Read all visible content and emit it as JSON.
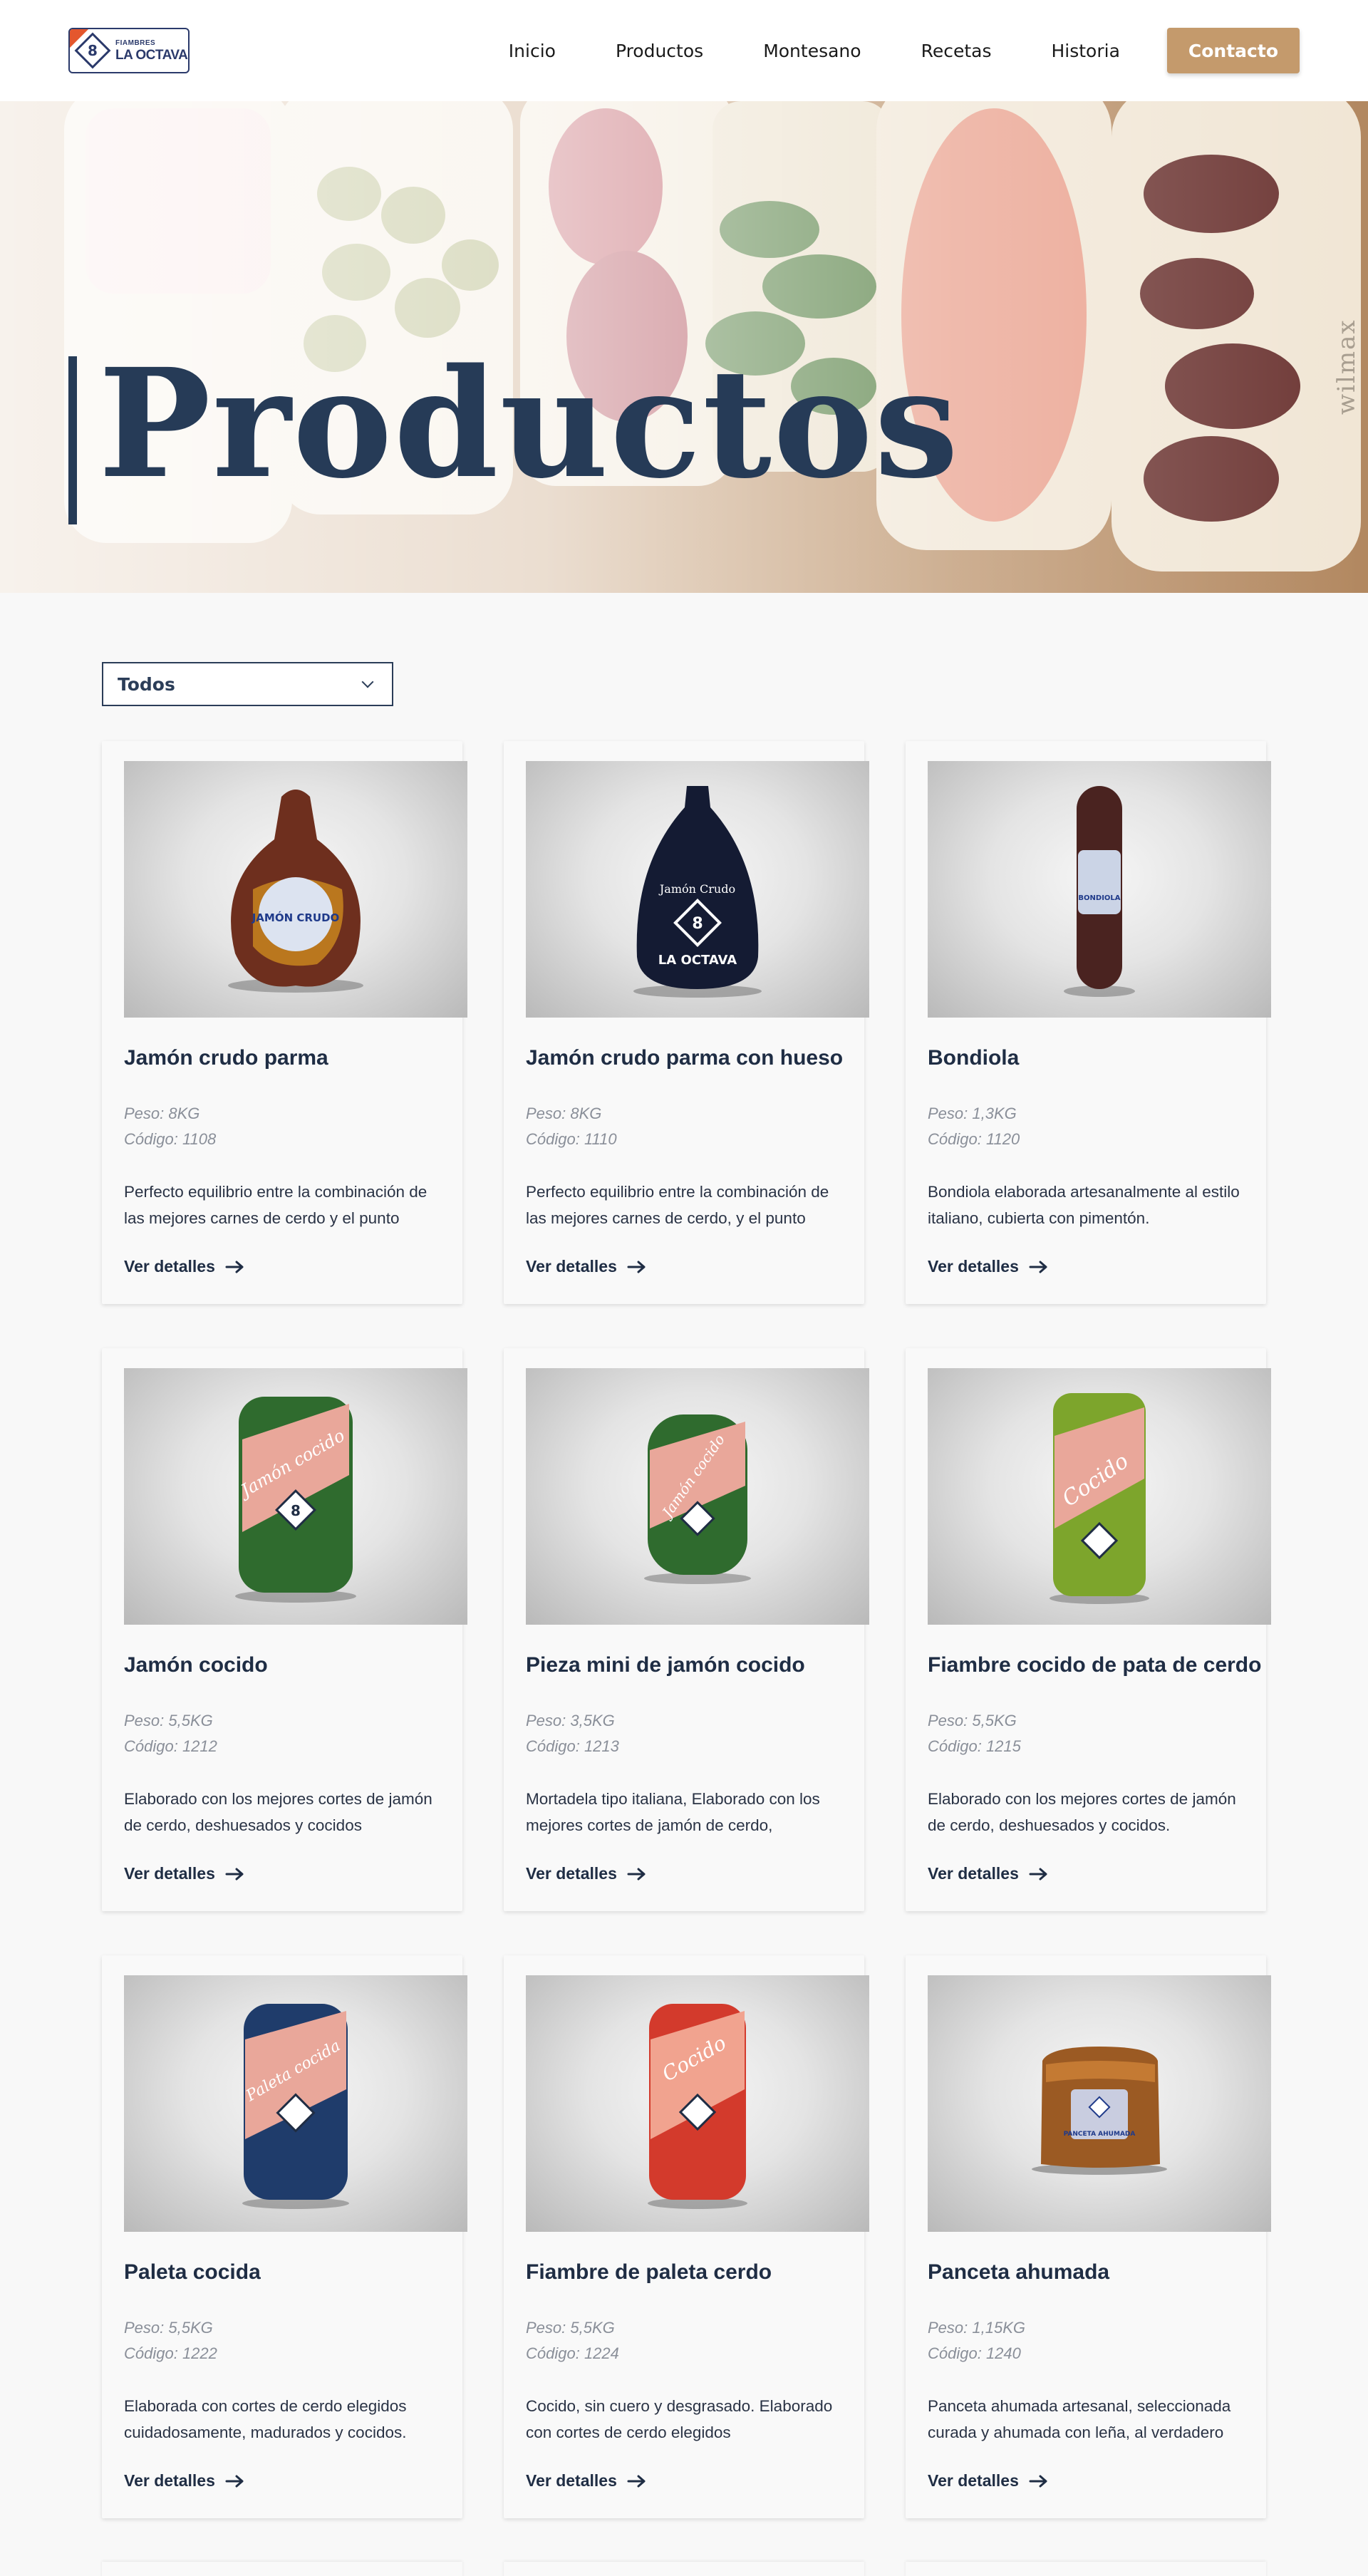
{
  "brand": {
    "small": "FIAMBRES",
    "name": "LA OCTAVA",
    "badge": "8"
  },
  "nav": {
    "items": [
      "Inicio",
      "Productos",
      "Montesano",
      "Recetas",
      "Historia"
    ],
    "cta": "Contacto"
  },
  "hero": {
    "title": "Productos",
    "watermark": "wilmax"
  },
  "filter": {
    "selected": "Todos"
  },
  "colors": {
    "primary": "#263b57",
    "accent": "#c49a6c",
    "logo_corner": "#e4572e"
  },
  "products": [
    {
      "name": "Jamón crudo parma",
      "weight": "Peso: 8KG",
      "code": "Código: 1108",
      "desc": "Perfecto equilibrio entre la combinación de las mejores carnes de cerdo y el punto",
      "link": "Ver detalles",
      "label": "JAMÓN CRUDO"
    },
    {
      "name": "Jamón crudo parma con hueso",
      "weight": "Peso: 8KG",
      "code": "Código: 1110",
      "desc": "Perfecto equilibrio entre la combinación de las mejores carnes de cerdo, y el punto",
      "link": "Ver detalles",
      "label": "Jamón Crudo"
    },
    {
      "name": "Bondiola",
      "weight": "Peso: 1,3KG",
      "code": "Código: 1120",
      "desc": "Bondiola elaborada artesanalmente al estilo italiano, cubierta con pimentón.",
      "link": "Ver detalles",
      "label": "BONDIOLA"
    },
    {
      "name": "Jamón cocido",
      "weight": "Peso: 5,5KG",
      "code": "Código: 1212",
      "desc": "Elaborado con los mejores cortes de jamón de cerdo, deshuesados y cocidos",
      "link": "Ver detalles",
      "label": "Jamón cocido"
    },
    {
      "name": "Pieza mini de jamón cocido",
      "weight": "Peso: 3,5KG",
      "code": "Código: 1213",
      "desc": "Mortadela tipo italiana, Elaborado con los mejores cortes de jamón de cerdo,",
      "link": "Ver detalles",
      "label": "Jamón cocido"
    },
    {
      "name": "Fiambre cocido de pata de cerdo",
      "weight": "Peso: 5,5KG",
      "code": "Código: 1215",
      "desc": "Elaborado con los mejores cortes de jamón de cerdo, deshuesados y cocidos.",
      "link": "Ver detalles",
      "label": "Cocido"
    },
    {
      "name": "Paleta cocida",
      "weight": "Peso: 5,5KG",
      "code": "Código: 1222",
      "desc": "Elaborada con cortes de cerdo elegidos cuidadosamente, madurados y cocidos.",
      "link": "Ver detalles",
      "label": "Paleta cocida"
    },
    {
      "name": "Fiambre de paleta cerdo",
      "weight": "Peso: 5,5KG",
      "code": "Código: 1224",
      "desc": "Cocido, sin cuero y desgrasado. Elaborado con cortes de cerdo elegidos",
      "link": "Ver detalles",
      "label": "Cocido"
    },
    {
      "name": "Panceta ahumada",
      "weight": "Peso: 1,15KG",
      "code": "Código: 1240",
      "desc": "Panceta ahumada artesanal, seleccionada curada y ahumada con leña, al verdadero",
      "link": "Ver detalles",
      "label": "PANCETA AHUMADA"
    }
  ]
}
